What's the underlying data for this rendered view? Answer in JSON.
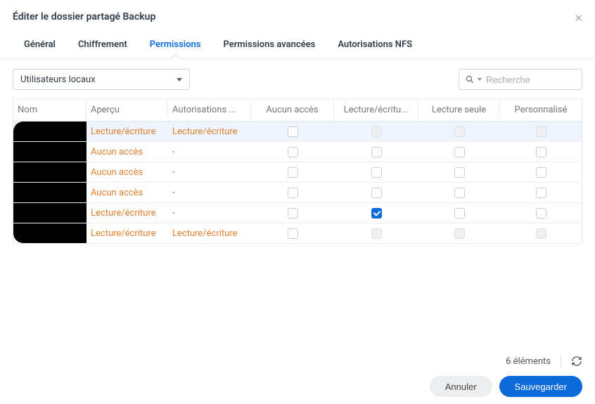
{
  "header": {
    "title": "Éditer le dossier partagé Backup"
  },
  "tabs": [
    {
      "label": "Général",
      "active": false
    },
    {
      "label": "Chiffrement",
      "active": false
    },
    {
      "label": "Permissions",
      "active": true
    },
    {
      "label": "Permissions avancées",
      "active": false
    },
    {
      "label": "Autorisations NFS",
      "active": false
    }
  ],
  "toolbar": {
    "dropdown_value": "Utilisateurs locaux",
    "search_placeholder": "Recherche"
  },
  "columns": {
    "name": "Nom",
    "preview": "Aperçu",
    "auth": "Autorisations ...",
    "noacc": "Aucun accès",
    "rw": "Lecture/écritu...",
    "ro": "Lecture seule",
    "custom": "Personnalisé"
  },
  "rows": [
    {
      "name": "",
      "preview": "Lecture/écriture",
      "auth": "Lecture/écriture",
      "noacc": "off",
      "rw": "disabled",
      "ro": "disabled",
      "custom": "disabled",
      "selected": true
    },
    {
      "name": "",
      "preview": "Aucun accès",
      "auth": "-",
      "noacc": "off",
      "rw": "off",
      "ro": "off",
      "custom": "off",
      "selected": false
    },
    {
      "name": "",
      "preview": "Aucun accès",
      "auth": "-",
      "noacc": "off",
      "rw": "off",
      "ro": "off",
      "custom": "off",
      "selected": false
    },
    {
      "name": "",
      "preview": "Aucun accès",
      "auth": "-",
      "noacc": "off",
      "rw": "off",
      "ro": "off",
      "custom": "off",
      "selected": false
    },
    {
      "name": "",
      "preview": "Lecture/écriture",
      "auth": "-",
      "noacc": "off",
      "rw": "checked",
      "ro": "off",
      "custom": "off",
      "selected": false
    },
    {
      "name": "",
      "preview": "Lecture/écriture",
      "auth": "Lecture/écriture",
      "noacc": "off",
      "rw": "disabled",
      "ro": "disabled",
      "custom": "disabled",
      "selected": false
    }
  ],
  "footer": {
    "count_label": "6 éléments",
    "cancel": "Annuler",
    "save": "Sauvegarder"
  }
}
